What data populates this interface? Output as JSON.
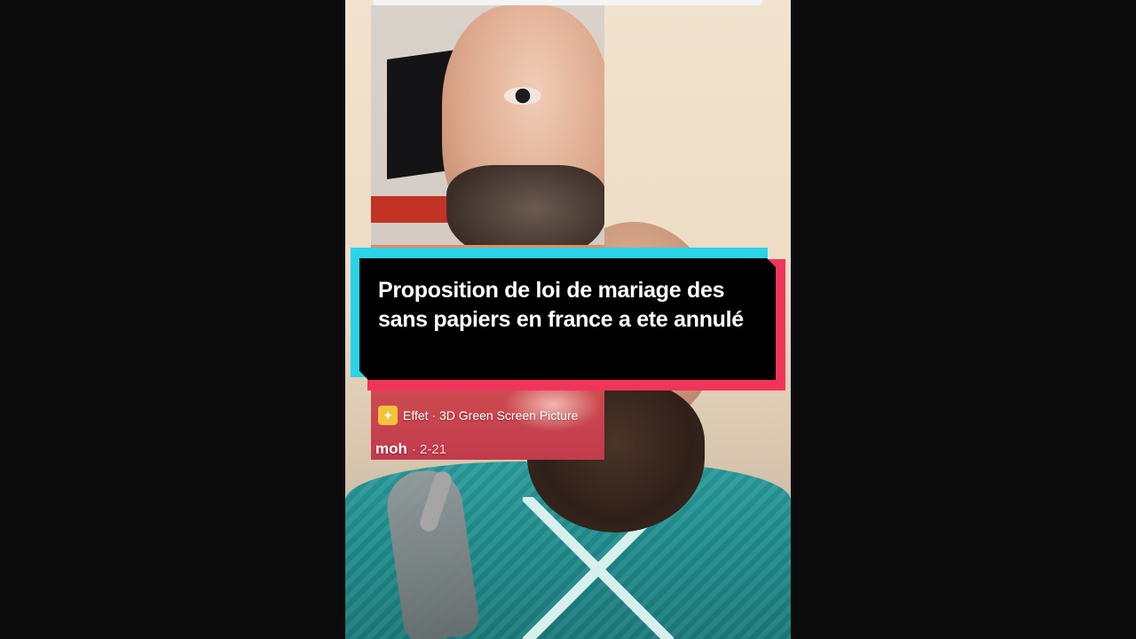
{
  "caption": {
    "text": "Proposition de loi de mariage des sans papiers en france a ete annulé"
  },
  "overlay": {
    "effect_label": "Effet · 3D Green Screen Picture",
    "author_name": "moh",
    "author_date": "· 2-21"
  },
  "icons": {
    "effect_icon": "effect-sparkle-icon"
  },
  "colors": {
    "caption_cyan": "#2bd3e8",
    "caption_red": "#f0355a",
    "caption_bg": "#000000",
    "effect_icon_bg": "#f4c23b"
  }
}
